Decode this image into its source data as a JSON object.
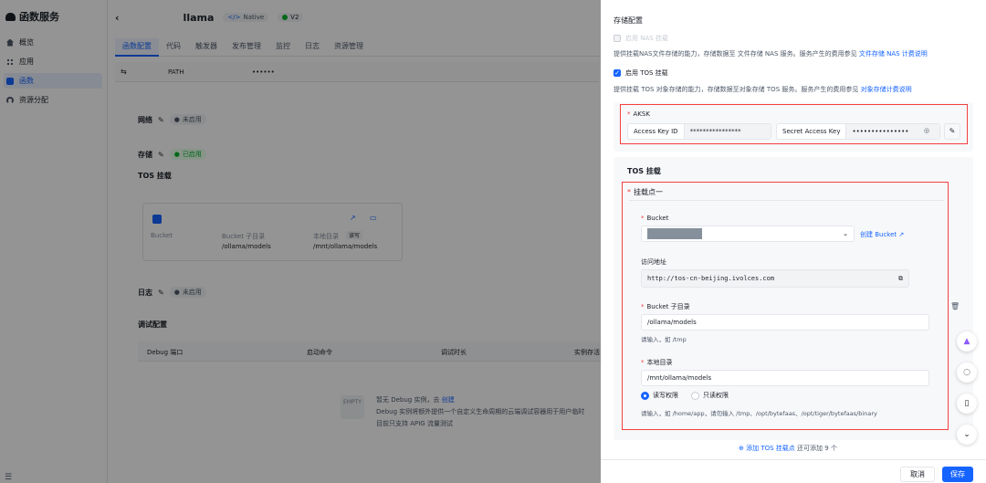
{
  "brand": "函数服务",
  "sidebar": {
    "items": [
      {
        "label": "概览",
        "icon": "home-icon"
      },
      {
        "label": "应用",
        "icon": "apps-icon"
      },
      {
        "label": "函数",
        "icon": "function-icon",
        "active": true
      },
      {
        "label": "资源分配",
        "icon": "gauge-icon"
      }
    ]
  },
  "header": {
    "func_name_suffix": "llama",
    "runtime": "Native",
    "version": "V2"
  },
  "tabs": [
    "函数配置",
    "代码",
    "触发器",
    "发布管理",
    "监控",
    "日志",
    "资源管理"
  ],
  "env": {
    "key": "PATH",
    "value": "••••••"
  },
  "network": {
    "title": "网络",
    "status": "未启用"
  },
  "storage": {
    "title": "存储",
    "status": "已启用",
    "tos_title": "TOS 挂载",
    "col_bucket": "Bucket",
    "col_subdir": "Bucket 子目录",
    "subdir": "/ollama/models",
    "col_local": "本地目录",
    "perm": "读写",
    "local": "/mnt/ollama/models"
  },
  "log": {
    "title": "日志",
    "status": "未启用"
  },
  "debug": {
    "title": "调试配置",
    "cols": [
      "Debug 端口",
      "启动命令",
      "调试时长",
      "实例存活"
    ],
    "empty_logo": "EMPTY",
    "empty_text": "暂无 Debug 实例，去",
    "empty_link": "创建",
    "empty_desc1": "Debug 实例将额外提供一个自定义生命周期的云端调试容器用于用户临时",
    "empty_desc2": "目前只支持 APIG 流量测试"
  },
  "drawer": {
    "title": "存储配置",
    "nas_label": "启用 NAS 挂载",
    "nas_desc": "提供挂载NAS文件存储的能力，存储数据至 文件存储 NAS 服务。服务产生的费用参见",
    "nas_link": "文件存储 NAS 计费说明",
    "tos_label": "启用 TOS 挂载",
    "tos_desc": "提供挂载 TOS 对象存储的能力，存储数据至对象存储 TOS 服务。服务产生的费用参见",
    "tos_link": "对象存储计费说明",
    "aksk_label": "AKSK",
    "ak_label": "Access Key ID",
    "ak_value": "****************",
    "sk_label": "Secret Access Key",
    "sk_value": "•••••••••••••••",
    "tos_section": "TOS 挂载",
    "mount_title": "挂载点一",
    "bucket_label": "Bucket",
    "create_bucket": "创建 Bucket",
    "url_label": "访问地址",
    "url_value": "http://tos-cn-beijing.ivolces.com",
    "subdir_label": "Bucket 子目录",
    "subdir_value": "/ollama/models",
    "subdir_hint": "请输入，如 /tmp",
    "local_label": "本地目录",
    "local_value": "/mnt/ollama/models",
    "perm_rw": "读写权限",
    "perm_ro": "只读权限",
    "local_hint": "请输入，如 /home/app，请勿输入 /tmp、/opt/bytefaas、/opt/tiger/bytefaas/binary",
    "add_mount": "添加 TOS 挂载点",
    "add_hint": "还可添加 9 个",
    "cancel": "取消",
    "save": "保存"
  },
  "colors": {
    "accent": "#1664ff",
    "danger": "#f53f3f",
    "success": "#00b42a"
  }
}
